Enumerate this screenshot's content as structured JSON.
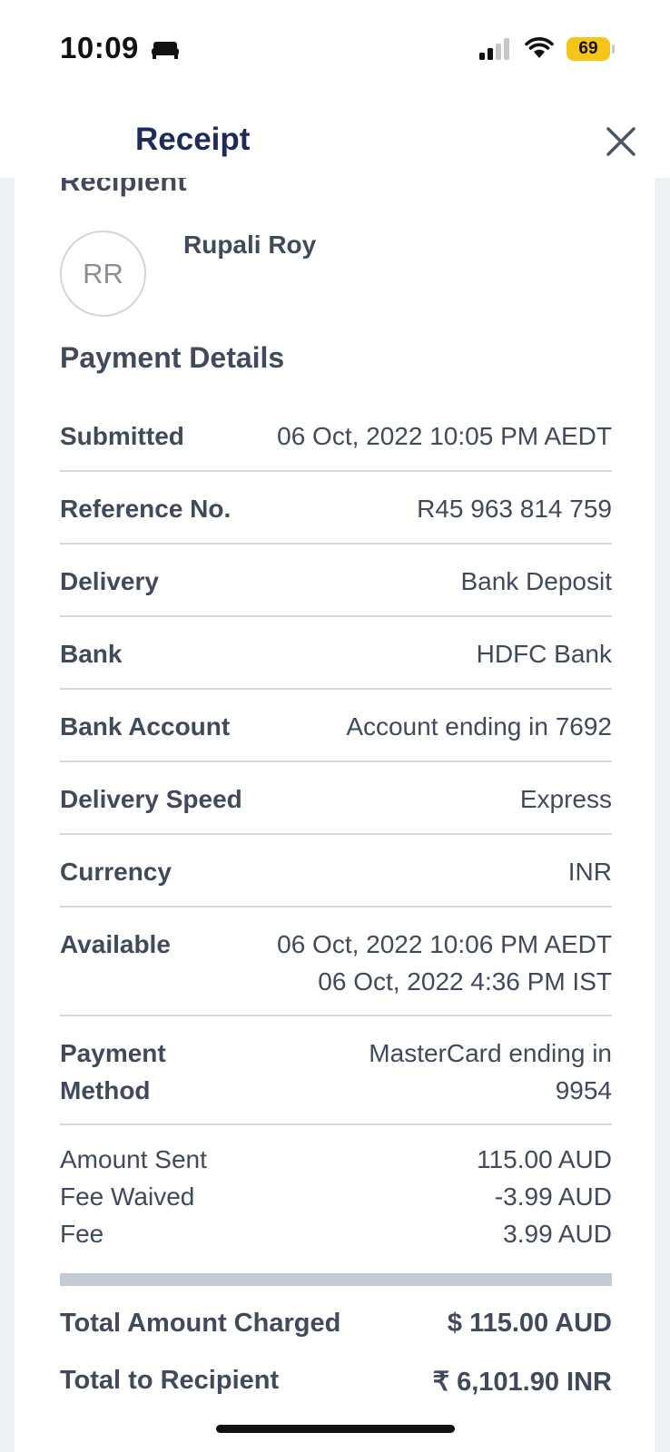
{
  "status_bar": {
    "time": "10:09",
    "battery": "69"
  },
  "header": {
    "title": "Receipt"
  },
  "recipient": {
    "section_title": "Recipient",
    "initials": "RR",
    "name": "Rupali Roy"
  },
  "payment_details": {
    "title": "Payment Details",
    "rows": [
      {
        "label": "Submitted",
        "value": "06 Oct, 2022 10:05 PM AEDT"
      },
      {
        "label": "Reference No.",
        "value": "R45 963 814 759"
      },
      {
        "label": "Delivery",
        "value": "Bank Deposit"
      },
      {
        "label": "Bank",
        "value": "HDFC Bank"
      },
      {
        "label": "Bank Account",
        "value": "Account ending in 7692"
      },
      {
        "label": "Delivery Speed",
        "value": "Express"
      },
      {
        "label": "Currency",
        "value": "INR"
      },
      {
        "label": "Available",
        "value_line1": "06 Oct, 2022 10:06 PM AEDT",
        "value_line2": "06 Oct, 2022 4:36 PM IST"
      },
      {
        "label_line1": "Payment",
        "label_line2": "Method",
        "value_line1": "MasterCard ending in",
        "value_line2": "9954"
      }
    ]
  },
  "amounts": [
    {
      "label": "Amount Sent",
      "value": "115.00 AUD"
    },
    {
      "label": "Fee Waived",
      "value": "-3.99 AUD"
    },
    {
      "label": "Fee",
      "value": "3.99 AUD"
    }
  ],
  "totals": [
    {
      "label": "Total Amount Charged",
      "value": "$ 115.00 AUD"
    },
    {
      "label": "Total to Recipient",
      "value": "₹ 6,101.90 INR"
    }
  ],
  "icons": {
    "bed": "bed-icon",
    "signal": "cellular-signal-icon",
    "wifi": "wifi-icon",
    "close": "close-icon"
  },
  "colors": {
    "title": "#1f2a5c",
    "text": "#404a5c",
    "divider": "#d3d9e0",
    "battery": "#f5c518"
  }
}
